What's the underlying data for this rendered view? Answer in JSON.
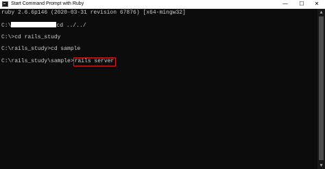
{
  "window": {
    "title": "Start Command Prompt with Ruby",
    "icon": "terminal-icon",
    "controls": {
      "minimize": "—",
      "maximize": "☐",
      "close": "✕"
    }
  },
  "console": {
    "lines": [
      "ruby 2.6.6p146 (2020-03-31 revision 67876) [x64-mingw32]",
      "",
      "C:\\",
      "cd ../../",
      "",
      "C:\\>cd rails_study",
      "",
      "C:\\rails_study>cd sample",
      "",
      "C:\\rails_study\\sample>",
      "rails server"
    ],
    "colors": {
      "background": "#0c0c0c",
      "text": "#cccccc",
      "highlight_box": "#e21c1c",
      "redaction": "#ffffff"
    }
  },
  "scrollbar": {
    "up_arrow": "▲",
    "down_arrow": "▼"
  }
}
